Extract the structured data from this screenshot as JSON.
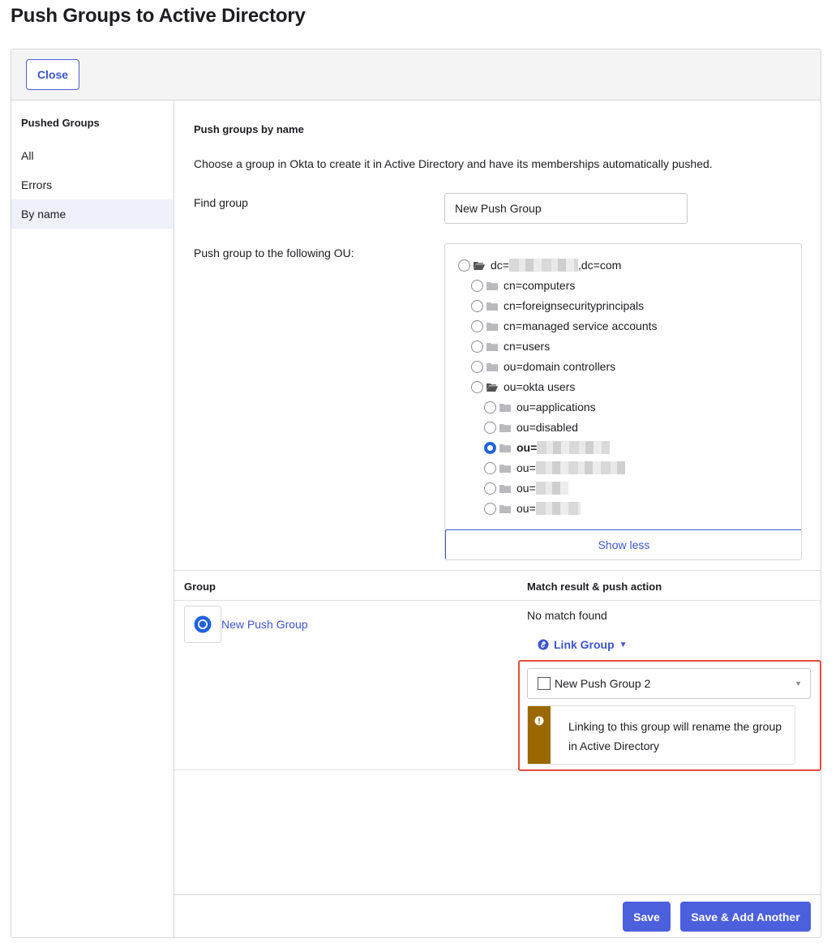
{
  "page": {
    "title": "Push Groups to Active Directory"
  },
  "header": {
    "close_label": "Close"
  },
  "sidebar": {
    "heading": "Pushed Groups",
    "items": [
      {
        "label": "All",
        "active": false
      },
      {
        "label": "Errors",
        "active": false
      },
      {
        "label": "By name",
        "active": true
      }
    ]
  },
  "main": {
    "section_title": "Push groups by name",
    "description": "Choose a group in Okta to create it in Active Directory and have its memberships automatically pushed.",
    "find_label": "Find group",
    "find_value": "New Push Group",
    "ou_label": "Push group to the following OU:",
    "ou_tree": [
      {
        "prefix": "dc=",
        "suffix": ",dc=com",
        "level": 0,
        "folder": "open",
        "selected": false,
        "redacted": true
      },
      {
        "prefix": "cn=computers",
        "suffix": "",
        "level": 1,
        "folder": "closed",
        "selected": false,
        "redacted": false
      },
      {
        "prefix": "cn=foreignsecurityprincipals",
        "suffix": "",
        "level": 1,
        "folder": "closed",
        "selected": false,
        "redacted": false
      },
      {
        "prefix": "cn=managed service accounts",
        "suffix": "",
        "level": 1,
        "folder": "closed",
        "selected": false,
        "redacted": false
      },
      {
        "prefix": "cn=users",
        "suffix": "",
        "level": 1,
        "folder": "closed",
        "selected": false,
        "redacted": false
      },
      {
        "prefix": "ou=domain controllers",
        "suffix": "",
        "level": 1,
        "folder": "closed",
        "selected": false,
        "redacted": false
      },
      {
        "prefix": "ou=okta users",
        "suffix": "",
        "level": 1,
        "folder": "open",
        "selected": false,
        "redacted": false
      },
      {
        "prefix": "ou=applications",
        "suffix": "",
        "level": 2,
        "folder": "closed",
        "selected": false,
        "redacted": false
      },
      {
        "prefix": "ou=disabled",
        "suffix": "",
        "level": 2,
        "folder": "closed",
        "selected": false,
        "redacted": false
      },
      {
        "prefix": "ou=",
        "suffix": "",
        "level": 2,
        "folder": "closed",
        "selected": true,
        "redacted": true
      },
      {
        "prefix": "ou=",
        "suffix": "",
        "level": 2,
        "folder": "closed",
        "selected": false,
        "redacted": true
      },
      {
        "prefix": "ou=",
        "suffix": "",
        "level": 2,
        "folder": "closed",
        "selected": false,
        "redacted": true
      },
      {
        "prefix": "ou=",
        "suffix": "",
        "level": 2,
        "folder": "closed",
        "selected": false,
        "redacted": true
      }
    ],
    "show_less_label": "Show less"
  },
  "table": {
    "col_group": "Group",
    "col_match": "Match result & push action",
    "row": {
      "group_name": "New Push Group",
      "match_result": "No match found",
      "action_label": "Link Group",
      "selected_group": "New Push Group 2",
      "warning_text": "Linking to this group will rename the group in Active Directory"
    }
  },
  "footer": {
    "save_label": "Save",
    "save_add_label": "Save & Add Another"
  },
  "colors": {
    "accent": "#3e55d1",
    "primary_button": "#4c5fdd",
    "warning": "#9b6800",
    "highlight": "#e74c3c",
    "radio_checked": "#1f62e0"
  },
  "icons": [
    "folder-open-icon",
    "folder-closed-icon",
    "radio-icon",
    "link-icon",
    "caret-down-icon",
    "warning-icon",
    "group-icon",
    "checkbox-icon"
  ]
}
